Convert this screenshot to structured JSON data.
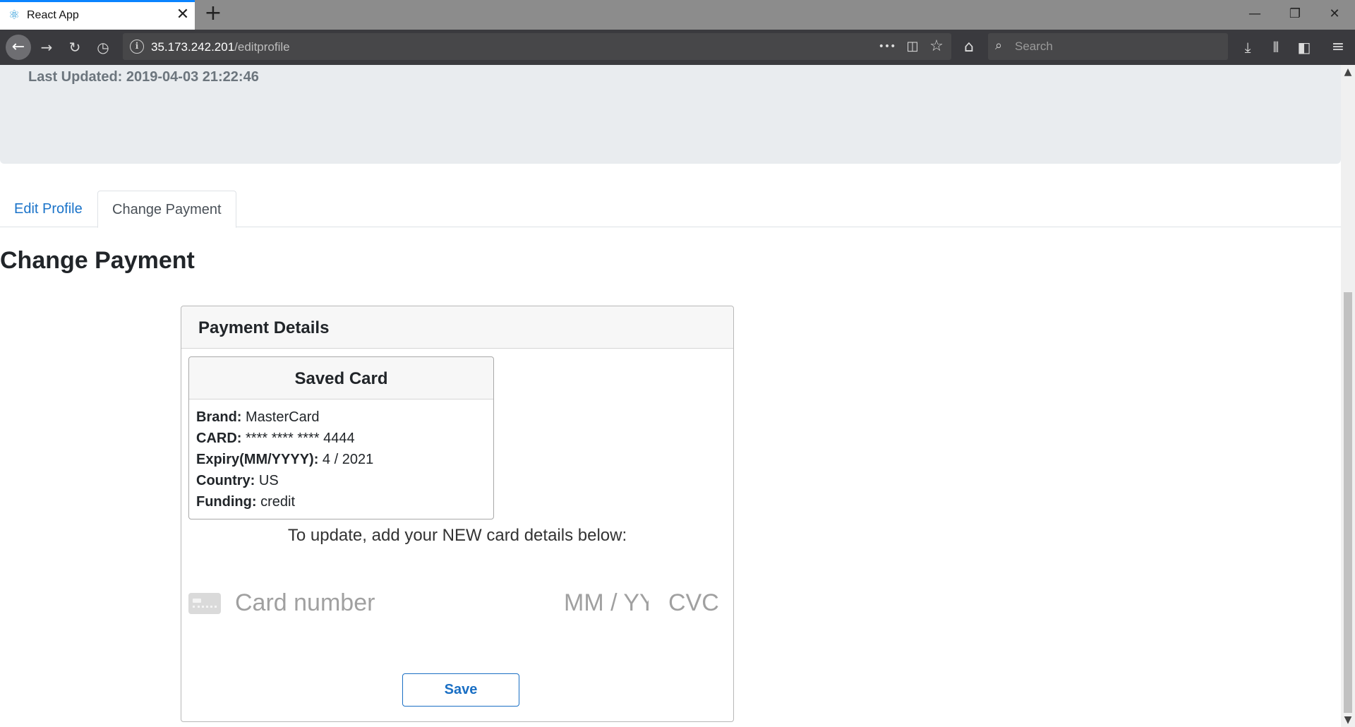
{
  "browser": {
    "tab_title": "React App",
    "tab_close": "✕",
    "new_tab": "+",
    "window_controls": {
      "minimize": "—",
      "restore": "❐",
      "close": "✕"
    },
    "url_host": "35.173.242.201",
    "url_path": "/editprofile",
    "search_placeholder": "Search",
    "icons": {
      "back": "←",
      "forward": "→",
      "reload": "↻",
      "history": "◷",
      "more": "•••",
      "pocket": "◫",
      "bookmark": "☆",
      "home": "⌂",
      "search": "⌕",
      "download": "⤓",
      "library": "⫴",
      "sidebar": "◧",
      "menu": "≡",
      "favicon": "⚛",
      "info": "i"
    }
  },
  "header": {
    "last_updated": "Last Updated: 2019-04-03 21:22:46"
  },
  "tabs": [
    {
      "label": "Edit Profile",
      "active": false
    },
    {
      "label": "Change Payment",
      "active": true
    }
  ],
  "page_title": "Change Payment",
  "payment": {
    "title": "Payment Details",
    "saved_card": {
      "title": "Saved Card",
      "brand_label": "Brand:",
      "brand": "MasterCard",
      "card_label": "CARD:",
      "card": "**** **** **** 4444",
      "expiry_label": "Expiry(MM/YYYY):",
      "expiry": "4 / 2021",
      "country_label": "Country:",
      "country": "US",
      "funding_label": "Funding:",
      "funding": "credit"
    },
    "update_note": "To update, add your NEW card details below:",
    "card_number_placeholder": "Card number",
    "expiry_placeholder": "MM / YY",
    "cvc_placeholder": "CVC",
    "save_label": "Save"
  },
  "scrollbar": {
    "up": "▲",
    "down": "▼"
  },
  "colors": {
    "accent": "#1a6fc4",
    "jumbotron": "#e9ecef",
    "browser_toolbar": "#3a3a3e",
    "tabstrip": "#8c8c8c"
  }
}
